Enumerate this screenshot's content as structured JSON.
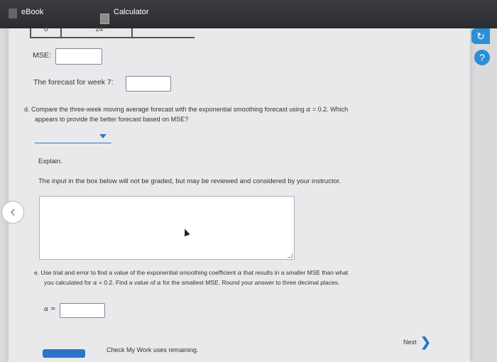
{
  "tabs": {
    "ebook": "eBook",
    "calculator": "Calculator"
  },
  "table_clip": {
    "left_value": "0",
    "right_value": "14"
  },
  "mse": {
    "label": "MSE:",
    "value": ""
  },
  "forecast_week7": {
    "label": "The forecast for week 7:",
    "value": ""
  },
  "part_d": {
    "text_line1_a": "d. Compare the three-week moving average forecast with the exponential smoothing forecast using",
    "alpha_symbol": "α",
    "text_line1_b": " = 0.2. Which",
    "text_line2": "appears to provide the better forecast based on MSE?",
    "dropdown_selected": ""
  },
  "explain": {
    "label": "Explain.",
    "note": "The input in the box below will not be graded, but may be reviewed and considered by your instructor.",
    "value": ""
  },
  "part_e": {
    "line1_a": "e. Use trial and error to find a value of the exponential smoothing coefficient",
    "line1_b": " that results in a smaller MSE than what",
    "line2_a": "you calculated for",
    "line2_b": " = 0.2. Find a value of",
    "line2_c": " for the smallest MSE. Round your answer to three decimal places.",
    "alpha_label": "α =",
    "alpha_value": ""
  },
  "footer": {
    "check_text": "Check My Work uses remaining.",
    "next_label": "Next"
  },
  "side_icons": {
    "top": "↻",
    "help": "?"
  }
}
